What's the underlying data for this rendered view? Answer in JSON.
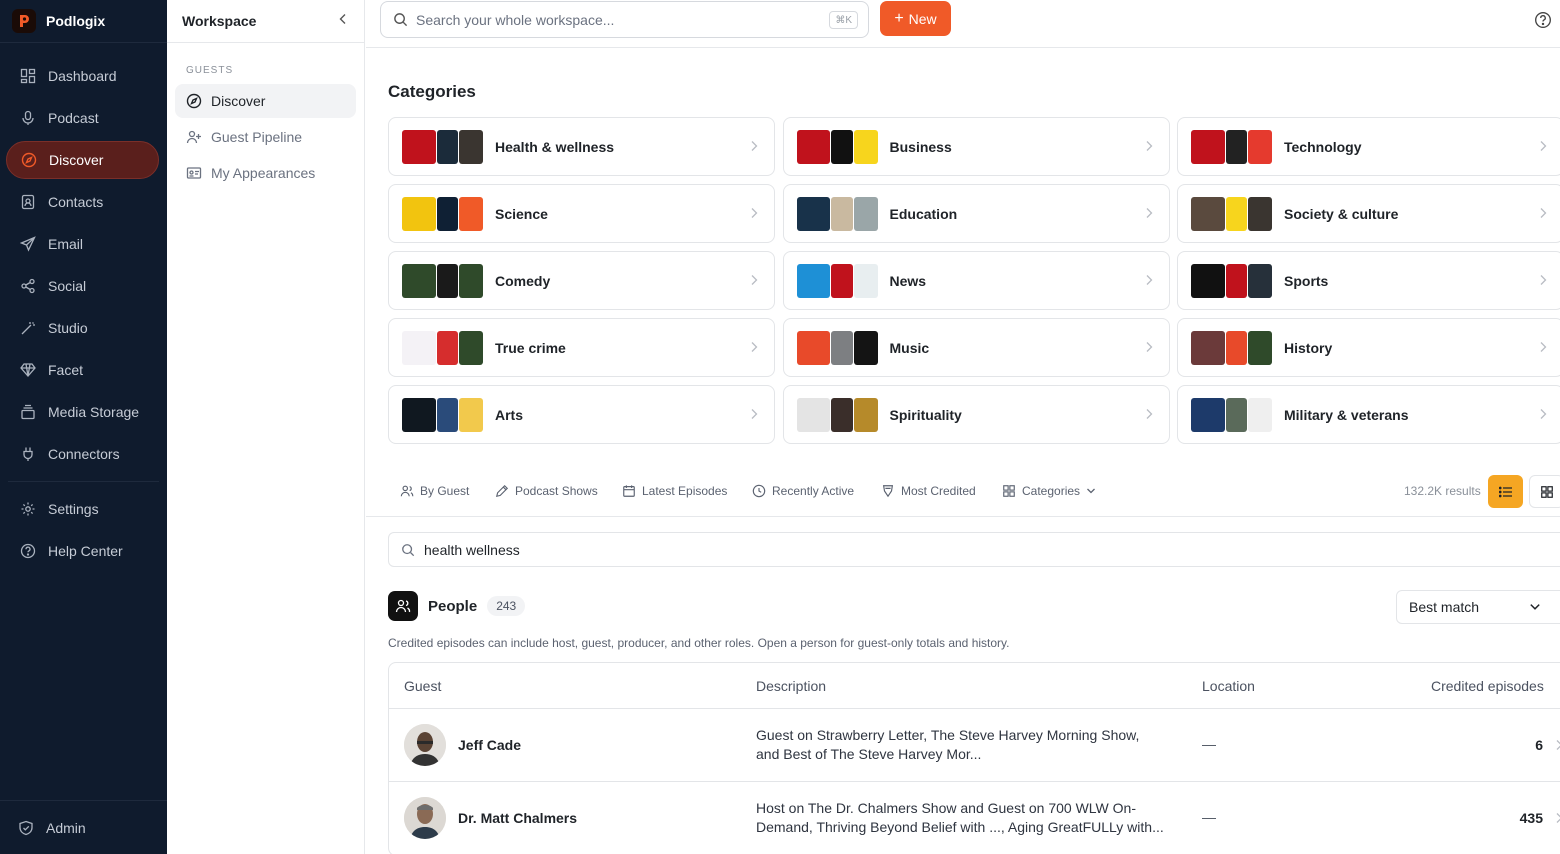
{
  "app": {
    "name": "Podlogix"
  },
  "nav": {
    "items": [
      {
        "label": "Dashboard",
        "icon": "dashboard-icon"
      },
      {
        "label": "Podcast",
        "icon": "microphone-icon"
      },
      {
        "label": "Discover",
        "icon": "compass-icon",
        "active": true
      },
      {
        "label": "Contacts",
        "icon": "contacts-icon"
      },
      {
        "label": "Email",
        "icon": "send-icon"
      },
      {
        "label": "Social",
        "icon": "share-icon"
      },
      {
        "label": "Studio",
        "icon": "magic-wand-icon"
      },
      {
        "label": "Facet",
        "icon": "gem-icon"
      },
      {
        "label": "Media Storage",
        "icon": "storage-icon"
      },
      {
        "label": "Connectors",
        "icon": "plug-icon"
      }
    ],
    "bottom_items": [
      {
        "label": "Settings",
        "icon": "gear-icon"
      },
      {
        "label": "Help Center",
        "icon": "help-circle-icon"
      }
    ],
    "admin": {
      "label": "Admin",
      "icon": "shield-icon"
    }
  },
  "subpanel": {
    "title": "Workspace",
    "section": "GUESTS",
    "items": [
      {
        "label": "Discover",
        "icon": "compass-icon",
        "active": true
      },
      {
        "label": "Guest Pipeline",
        "icon": "user-plus-icon"
      },
      {
        "label": "My Appearances",
        "icon": "id-card-icon"
      }
    ]
  },
  "topbar": {
    "search_placeholder": "Search your whole workspace...",
    "shortcut": "⌘K",
    "new_label": "New"
  },
  "categories": {
    "title": "Categories",
    "items": [
      {
        "label": "Health & wellness",
        "colors": [
          "#c0121c",
          "#1b2b3a",
          "#3a3530"
        ]
      },
      {
        "label": "Business",
        "colors": [
          "#c0121c",
          "#111111",
          "#f7d51d"
        ]
      },
      {
        "label": "Technology",
        "colors": [
          "#c0121c",
          "#222222",
          "#e53a2e"
        ]
      },
      {
        "label": "Science",
        "colors": [
          "#f2c40f",
          "#0f2034",
          "#f05a28"
        ]
      },
      {
        "label": "Education",
        "colors": [
          "#18324a",
          "#c9b9a0",
          "#9aa6a8"
        ]
      },
      {
        "label": "Society & culture",
        "colors": [
          "#5a4a3e",
          "#f7d51d",
          "#3a3530"
        ]
      },
      {
        "label": "Comedy",
        "colors": [
          "#2f4a2a",
          "#1a1a1a",
          "#2f4a2a"
        ]
      },
      {
        "label": "News",
        "colors": [
          "#1e90d6",
          "#c0121c",
          "#e8eef0"
        ]
      },
      {
        "label": "Sports",
        "colors": [
          "#111111",
          "#c0121c",
          "#26303a"
        ]
      },
      {
        "label": "True crime",
        "colors": [
          "#f4f2f6",
          "#d62d2d",
          "#2f4a2a"
        ]
      },
      {
        "label": "Music",
        "colors": [
          "#e84a2a",
          "#7d7f82",
          "#141414"
        ]
      },
      {
        "label": "History",
        "colors": [
          "#6b3a3a",
          "#e84a2a",
          "#2f4a2a"
        ]
      },
      {
        "label": "Arts",
        "colors": [
          "#101820",
          "#2a4b7a",
          "#f2c94c"
        ]
      },
      {
        "label": "Spirituality",
        "colors": [
          "#e4e4e4",
          "#3a2e2a",
          "#b68a2a"
        ]
      },
      {
        "label": "Military & veterans",
        "colors": [
          "#1d3a6a",
          "#5a6a5a",
          "#efefef"
        ]
      }
    ]
  },
  "tabs": [
    {
      "label": "By Guest",
      "icon": "users-icon"
    },
    {
      "label": "Podcast Shows",
      "icon": "pen-icon"
    },
    {
      "label": "Latest Episodes",
      "icon": "calendar-icon"
    },
    {
      "label": "Recently Active",
      "icon": "clock-icon"
    },
    {
      "label": "Most Credited",
      "icon": "badge-icon"
    },
    {
      "label": "Categories",
      "icon": "grid-icon"
    }
  ],
  "results": {
    "count_text": "132.2K results"
  },
  "filter": {
    "value": "health wellness"
  },
  "people": {
    "title": "People",
    "count": "243",
    "note": "Credited episodes can include host, guest, producer, and other roles. Open a person for guest-only totals and history.",
    "sort_label": "Best match",
    "columns": {
      "guest": "Guest",
      "description": "Description",
      "location": "Location",
      "credited": "Credited episodes"
    },
    "rows": [
      {
        "name": "Jeff Cade",
        "description": "Guest on Strawberry Letter, The Steve Harvey Morning Show, and Best of The Steve Harvey Mor...",
        "location": "—",
        "credited": "6"
      },
      {
        "name": "Dr. Matt Chalmers",
        "description": "Host on The Dr. Chalmers Show and Guest on 700 WLW On-Demand, Thriving Beyond Belief with ..., Aging GreatFULLy with...",
        "location": "—",
        "credited": "435"
      }
    ]
  }
}
